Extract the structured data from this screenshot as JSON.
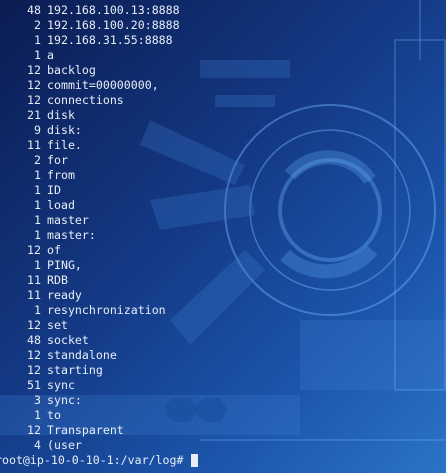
{
  "terminal": {
    "lines": [
      {
        "count": "48",
        "word": "192.168.100.13:8888"
      },
      {
        "count": "2",
        "word": "192.168.100.20:8888"
      },
      {
        "count": "1",
        "word": "192.168.31.55:8888"
      },
      {
        "count": "1",
        "word": "a"
      },
      {
        "count": "12",
        "word": "backlog"
      },
      {
        "count": "12",
        "word": "commit=00000000,"
      },
      {
        "count": "12",
        "word": "connections"
      },
      {
        "count": "21",
        "word": "disk"
      },
      {
        "count": "9",
        "word": "disk:"
      },
      {
        "count": "11",
        "word": "file."
      },
      {
        "count": "2",
        "word": "for"
      },
      {
        "count": "1",
        "word": "from"
      },
      {
        "count": "1",
        "word": "ID"
      },
      {
        "count": "1",
        "word": "load"
      },
      {
        "count": "1",
        "word": "master"
      },
      {
        "count": "1",
        "word": "master:"
      },
      {
        "count": "12",
        "word": "of"
      },
      {
        "count": "1",
        "word": "PING,"
      },
      {
        "count": "11",
        "word": "RDB"
      },
      {
        "count": "11",
        "word": "ready"
      },
      {
        "count": "1",
        "word": "resynchronization"
      },
      {
        "count": "12",
        "word": "set"
      },
      {
        "count": "48",
        "word": "socket"
      },
      {
        "count": "12",
        "word": "standalone"
      },
      {
        "count": "12",
        "word": "starting"
      },
      {
        "count": "51",
        "word": "sync"
      },
      {
        "count": "3",
        "word": "sync:"
      },
      {
        "count": "1",
        "word": "to"
      },
      {
        "count": "12",
        "word": "Transparent"
      },
      {
        "count": "4",
        "word": "(user"
      }
    ],
    "prompt": "root@ip-10-0-10-1:/var/log# "
  },
  "colors": {
    "text": "#e8eef8",
    "background_dark": "#0b1c52",
    "background_light": "#2a74c7",
    "wallpaper_accent": "#6fb4ff"
  }
}
